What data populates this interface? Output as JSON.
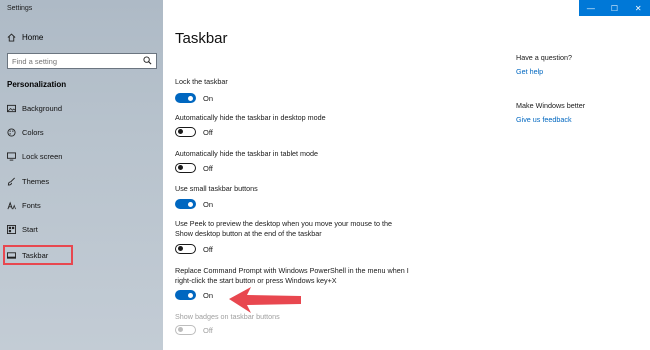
{
  "window": {
    "title": "Settings",
    "controls": {
      "minimize": "—",
      "maximize": "☐",
      "close": "✕"
    }
  },
  "sidebar": {
    "home_label": "Home",
    "search_placeholder": "Find a setting",
    "section_label": "Personalization",
    "items": [
      {
        "label": "Background",
        "icon": "image-icon"
      },
      {
        "label": "Colors",
        "icon": "palette-icon"
      },
      {
        "label": "Lock screen",
        "icon": "monitor-lock-icon"
      },
      {
        "label": "Themes",
        "icon": "brush-icon"
      },
      {
        "label": "Fonts",
        "icon": "font-icon"
      },
      {
        "label": "Start",
        "icon": "start-icon"
      },
      {
        "label": "Taskbar",
        "icon": "taskbar-icon",
        "selected": true
      }
    ]
  },
  "main": {
    "title": "Taskbar",
    "settings": [
      {
        "label": "Lock the taskbar",
        "state": "On"
      },
      {
        "label": "Automatically hide the taskbar in desktop mode",
        "state": "Off"
      },
      {
        "label": "Automatically hide the taskbar in tablet mode",
        "state": "Off"
      },
      {
        "label": "Use small taskbar buttons",
        "state": "On"
      },
      {
        "label": "Use Peek to preview the desktop when you move your mouse to the Show desktop button at the end of the taskbar",
        "state": "Off"
      },
      {
        "label": "Replace Command Prompt with Windows PowerShell in the menu when I right-click the start button or press Windows key+X",
        "state": "On"
      },
      {
        "label": "Show badges on taskbar buttons",
        "state": "Off",
        "disabled": true
      }
    ]
  },
  "help": {
    "question_heading": "Have a question?",
    "question_link": "Get help",
    "feedback_heading": "Make Windows better",
    "feedback_link": "Give us feedback"
  },
  "colors": {
    "accent": "#0067c0",
    "highlight": "#e8474f"
  }
}
